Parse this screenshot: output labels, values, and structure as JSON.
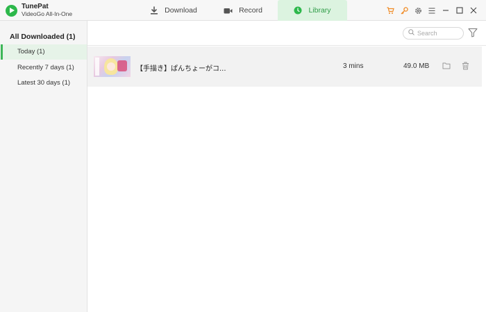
{
  "app": {
    "name": "TunePat",
    "subtitle": "VideoGo All-In-One"
  },
  "tabs": [
    {
      "label": "Download",
      "icon": "download-icon"
    },
    {
      "label": "Record",
      "icon": "video-camera-icon"
    },
    {
      "label": "Library",
      "icon": "clock-icon",
      "active": true
    }
  ],
  "window_controls": [
    "cart-icon",
    "key-icon",
    "gear-icon",
    "menu-icon",
    "minimize-icon",
    "maximize-icon",
    "close-icon"
  ],
  "sidebar": {
    "header": "All Downloaded (1)",
    "items": [
      {
        "label": "Today (1)",
        "active": true
      },
      {
        "label": "Recently 7 days (1)"
      },
      {
        "label": "Latest 30 days (1)"
      }
    ]
  },
  "search": {
    "placeholder": "Search",
    "value": ""
  },
  "library": {
    "rows": [
      {
        "title": "【手描き】ぱんちょーがコ...",
        "duration": "3 mins",
        "size": "49.0 MB"
      }
    ]
  },
  "colors": {
    "accent": "#2db84b",
    "tab_active_bg": "#dcf3e0",
    "sidebar_active_bg": "#e6f3e8",
    "row_bg": "#f2f2f2"
  }
}
